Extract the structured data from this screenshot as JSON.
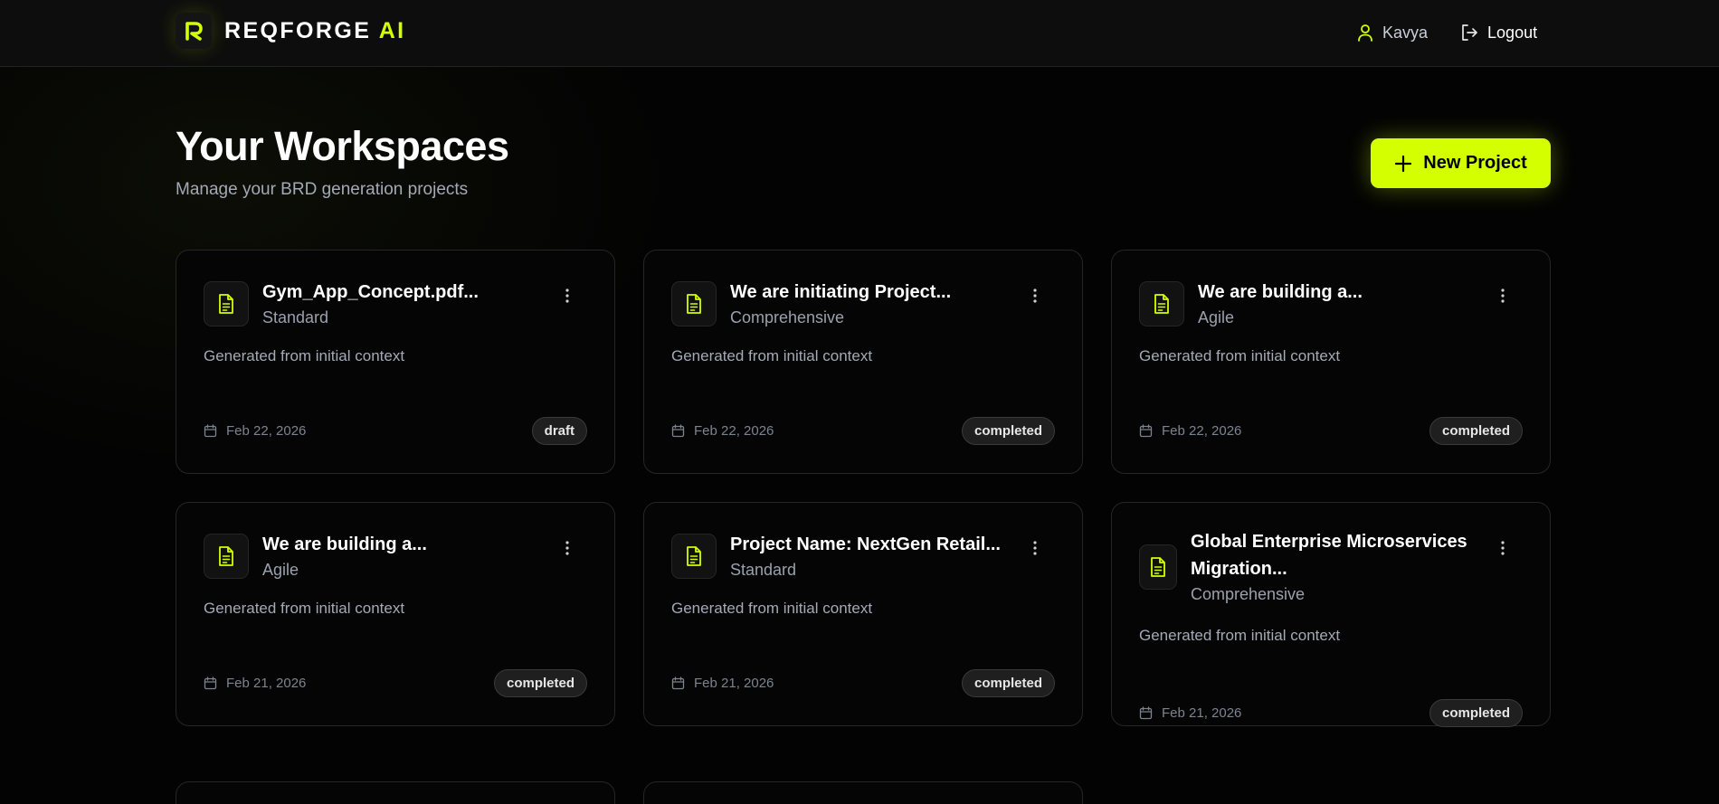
{
  "brand": {
    "name": "REQFORGE",
    "accent": "AI"
  },
  "header": {
    "user_name": "Kavya",
    "logout_label": "Logout"
  },
  "page": {
    "title": "Your Workspaces",
    "subtitle": "Manage your BRD generation projects",
    "new_project_label": "New Project"
  },
  "colors": {
    "accent": "#d4ff00",
    "background": "#030303",
    "card_border": "#262626"
  },
  "projects": [
    {
      "title": "Gym_App_Concept.pdf...",
      "type": "Standard",
      "description": "Generated from initial context",
      "date": "Feb 22, 2026",
      "status": "draft"
    },
    {
      "title": "We are initiating Project...",
      "type": "Comprehensive",
      "description": "Generated from initial context",
      "date": "Feb 22, 2026",
      "status": "completed"
    },
    {
      "title": "We are building a...",
      "type": "Agile",
      "description": "Generated from initial context",
      "date": "Feb 22, 2026",
      "status": "completed"
    },
    {
      "title": "We are building a...",
      "type": "Agile",
      "description": "Generated from initial context",
      "date": "Feb 21, 2026",
      "status": "completed"
    },
    {
      "title": "Project Name: NextGen Retail...",
      "type": "Standard",
      "description": "Generated from initial context",
      "date": "Feb 21, 2026",
      "status": "completed"
    },
    {
      "title": "Global Enterprise Microservices Migration...",
      "type": "Comprehensive",
      "description": "Generated from initial context",
      "date": "Feb 21, 2026",
      "status": "completed"
    }
  ],
  "icons": {
    "logo": "r-logo-icon",
    "user": "user-icon",
    "logout": "logout-icon",
    "plus": "plus-icon",
    "document": "document-icon",
    "menu": "kebab-menu-icon",
    "calendar": "calendar-icon"
  }
}
